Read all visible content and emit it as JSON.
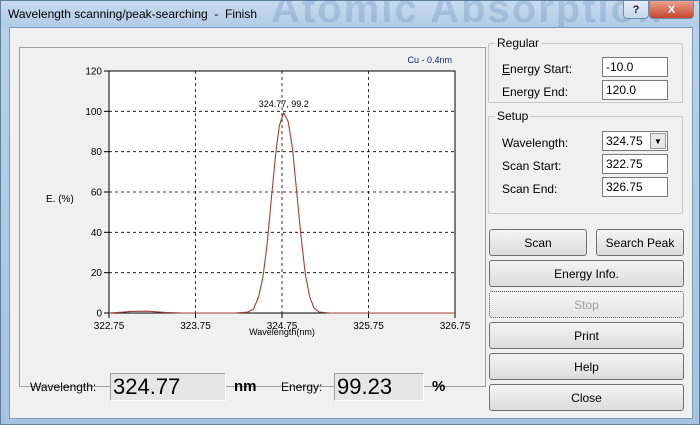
{
  "window": {
    "title": "Wavelength scanning/peak-searching  -  Finish",
    "watermark": "Atomic Absorption",
    "help_button": "?",
    "close_button": "X"
  },
  "chart_data": {
    "type": "line",
    "tag": "Cu - 0.4nm",
    "xlabel": "Wavelength(nm)",
    "ylabel": "E. (%)",
    "xlim": [
      322.75,
      326.75
    ],
    "ylim": [
      0,
      120
    ],
    "x_ticks": [
      "322.75",
      "323.75",
      "324.75",
      "325.75",
      "326.75"
    ],
    "y_ticks": [
      "120",
      "100",
      "80",
      "60",
      "40",
      "20",
      "0"
    ],
    "grid": true,
    "series_color": "#a0403a",
    "peak_label": "324.77, 99.2",
    "peak": {
      "x": 324.77,
      "y": 99.2
    },
    "points": [
      [
        322.75,
        0.0
      ],
      [
        322.9,
        0.4
      ],
      [
        323.0,
        0.8
      ],
      [
        323.2,
        0.9
      ],
      [
        323.4,
        0.3
      ],
      [
        323.6,
        0.0
      ],
      [
        324.0,
        0.0
      ],
      [
        324.2,
        0.0
      ],
      [
        324.35,
        0.4
      ],
      [
        324.42,
        2
      ],
      [
        324.48,
        8
      ],
      [
        324.53,
        18
      ],
      [
        324.58,
        35
      ],
      [
        324.63,
        58
      ],
      [
        324.68,
        80
      ],
      [
        324.72,
        93
      ],
      [
        324.77,
        99.2
      ],
      [
        324.82,
        95
      ],
      [
        324.87,
        82
      ],
      [
        324.92,
        60
      ],
      [
        324.97,
        38
      ],
      [
        325.02,
        19
      ],
      [
        325.07,
        8
      ],
      [
        325.12,
        2.5
      ],
      [
        325.18,
        0.5
      ],
      [
        325.3,
        0.0
      ],
      [
        325.75,
        0.0
      ],
      [
        326.3,
        0.0
      ],
      [
        326.75,
        0.0
      ]
    ]
  },
  "readout": {
    "wavelength_label": "Wavelength:",
    "wavelength_value": "324.77",
    "wavelength_unit": "nm",
    "energy_label": "Energy:",
    "energy_value": "99.23",
    "energy_unit": "%"
  },
  "regular": {
    "title": "Regular",
    "energy_start_label": "Energy Start:",
    "energy_start_value": "-10.0",
    "energy_end_label": "Energy End:",
    "energy_end_value": "120.0"
  },
  "setup": {
    "title": "Setup",
    "wavelength_label": "Wavelength:",
    "wavelength_value": "324.75",
    "scan_start_label": "Scan Start:",
    "scan_start_value": "322.75",
    "scan_end_label": "Scan End:",
    "scan_end_value": "326.75"
  },
  "buttons": {
    "scan": "Scan",
    "search_peak": "Search Peak",
    "energy_info": "Energy Info.",
    "stop": "Stop",
    "print": "Print",
    "help": "Help",
    "close": "Close"
  }
}
